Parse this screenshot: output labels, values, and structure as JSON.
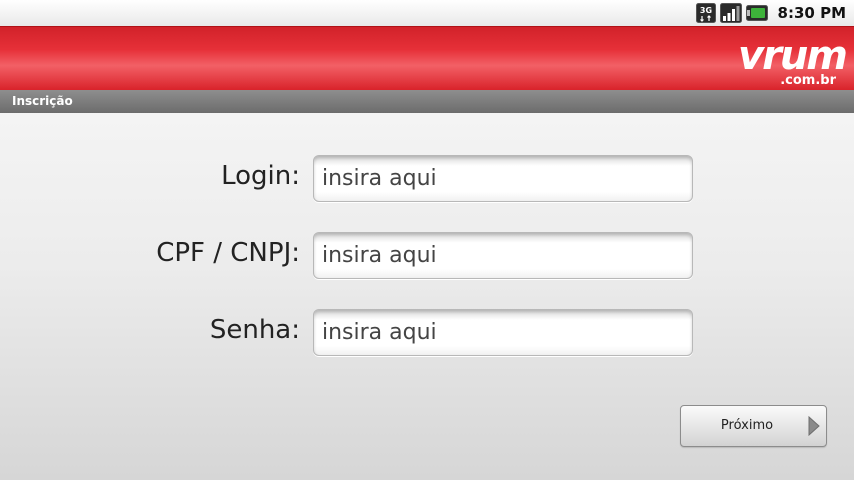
{
  "status_bar": {
    "time": "8:30 PM",
    "icons": [
      "3g-icon",
      "signal-icon",
      "battery-icon"
    ],
    "network_label": "3G"
  },
  "header": {
    "logo_text": "vrum",
    "logo_domain": ".com.br",
    "brand_color": "#e1252d"
  },
  "subtitle": "Inscrição",
  "form": {
    "fields": [
      {
        "label": "Login:",
        "placeholder": "insira aqui"
      },
      {
        "label": "CPF / CNPJ:",
        "placeholder": "insira aqui"
      },
      {
        "label": "Senha:",
        "placeholder": "insira aqui"
      }
    ]
  },
  "next_button": {
    "label": "Próximo",
    "icon": "arrow-right-icon"
  }
}
